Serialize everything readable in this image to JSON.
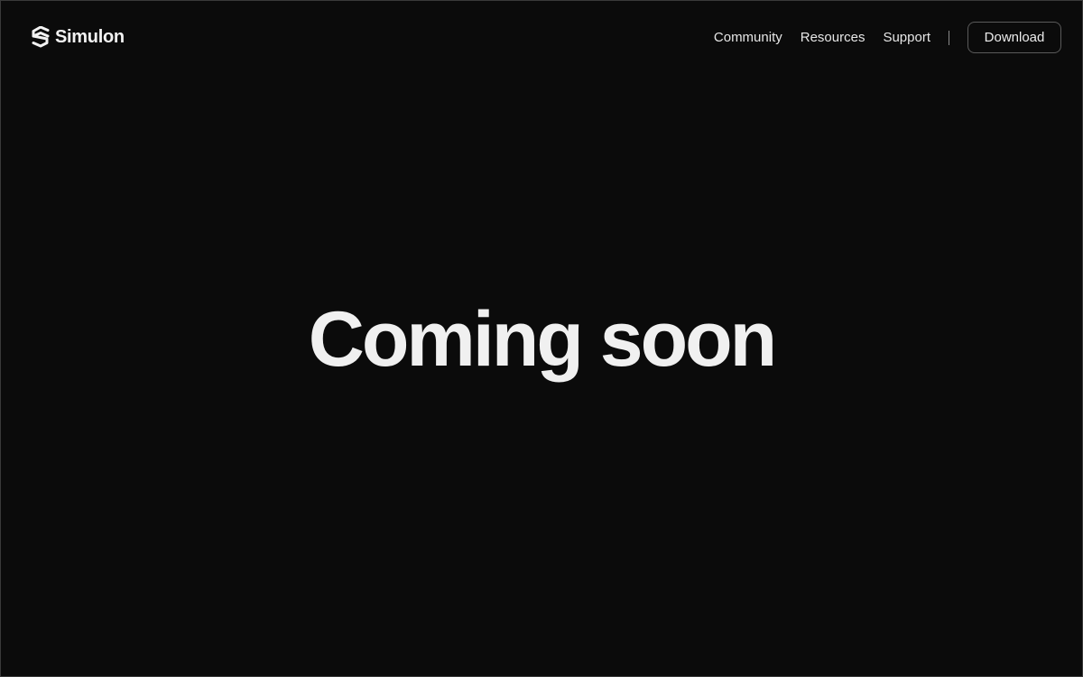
{
  "brand": {
    "name": "Simulon",
    "icon": "simulon-logo-icon"
  },
  "nav": {
    "links": [
      {
        "label": "Community"
      },
      {
        "label": "Resources"
      },
      {
        "label": "Support"
      }
    ],
    "download_label": "Download"
  },
  "hero": {
    "title": "Coming soon"
  },
  "colors": {
    "background": "#0b0b0b",
    "text": "#f0f0f0",
    "button_border": "#5a5a5a",
    "divider": "#8a8a8a"
  }
}
